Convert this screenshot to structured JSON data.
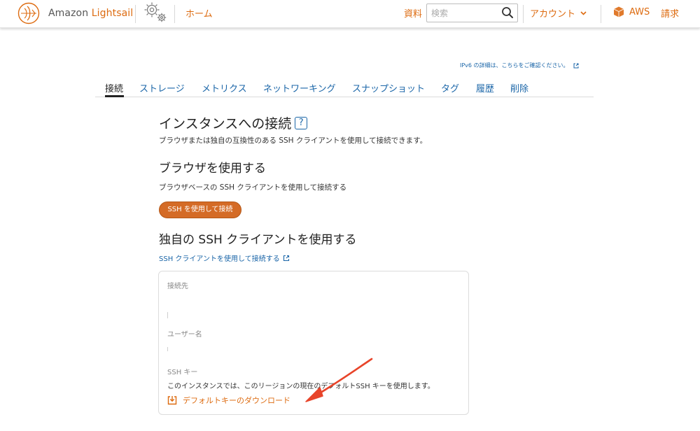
{
  "header": {
    "logo_prefix": "Amazon",
    "logo_brand": "Lightsail",
    "home_label": "ホーム",
    "docs_label": "資料",
    "search_placeholder": "検索",
    "account_label": "アカウント",
    "aws_label": "AWS",
    "billing_label": "請求"
  },
  "ipv6_notice": "IPv6 の詳細は、こちらをご確認ください。",
  "tabs": [
    "接続",
    "ストレージ",
    "メトリクス",
    "ネットワーキング",
    "スナップショット",
    "タグ",
    "履歴",
    "削除"
  ],
  "active_tab": "接続",
  "connect": {
    "title": "インスタンスへの接続",
    "help_icon_text": "?",
    "description": "ブラウザまたは独自の互換性のある SSH クライアントを使用して接続できます。",
    "browser_heading": "ブラウザを使用する",
    "browser_description": "ブラウザベースの SSH クライアントを使用して接続する",
    "ssh_button": "SSH を使用して接続",
    "own_client_heading": "独自の SSH クライアントを使用する",
    "own_client_link": "SSH クライアントを使用して接続する",
    "connect_to_label": "接続先",
    "username_label": "ユーザー名",
    "ssh_key_label": "SSH キー",
    "ssh_key_info": "このインスタンスでは、このリージョンの現在のデフォルトSSH キーを使用します。",
    "download_label": "デフォルトキーのダウンロード"
  },
  "colors": {
    "accent": "#dd6b10",
    "link": "#1b66a8",
    "button": "#d46b26",
    "annotation_arrow": "#e8442a"
  }
}
